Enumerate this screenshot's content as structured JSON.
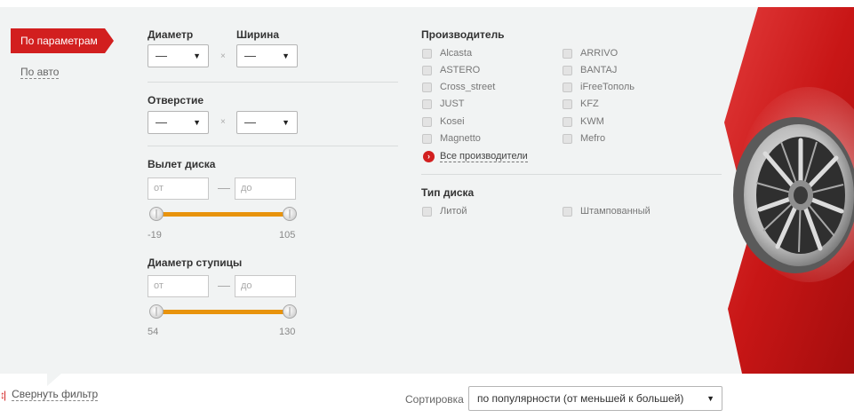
{
  "tabs": {
    "by_params": "По параметрам",
    "by_car": "По авто"
  },
  "diameter": {
    "label": "Диаметр",
    "value": "—"
  },
  "width": {
    "label": "Ширина",
    "value": "—"
  },
  "bolt_pattern": {
    "label": "Отверстие",
    "value_a": "—",
    "value_b": "—"
  },
  "separator": "×",
  "offset": {
    "label": "Вылет диска",
    "from_placeholder": "от",
    "to_placeholder": "до",
    "min": "-19",
    "max": "105"
  },
  "hub": {
    "label": "Диаметр ступицы",
    "from_placeholder": "от",
    "to_placeholder": "до",
    "min": "54",
    "max": "130"
  },
  "manufacturer": {
    "label": "Производитель",
    "col1": [
      "Alcasta",
      "ASTERO",
      "Cross_street",
      "JUST",
      "Kosei",
      "Magnetto"
    ],
    "col2": [
      "ARRIVO",
      "BANTAJ",
      "iFreeТополь",
      "KFZ",
      "KWM",
      "Mefro"
    ],
    "all_link": "Все производители"
  },
  "disk_type": {
    "label": "Тип диска",
    "options": [
      "Литой",
      "Штампованный"
    ]
  },
  "footer": {
    "collapse": "Свернуть фильтр",
    "sort_label": "Сортировка",
    "sort_value": "по популярности (от меньшей к большей)"
  },
  "colors": {
    "accent": "#d21f1f",
    "slider": "#e8930c",
    "panel": "#f1f3f3"
  },
  "icons": {
    "dropdown": "triangle-down-icon",
    "arrow": "chevron-right-icon",
    "collapse": "collapse-filter-icon"
  }
}
